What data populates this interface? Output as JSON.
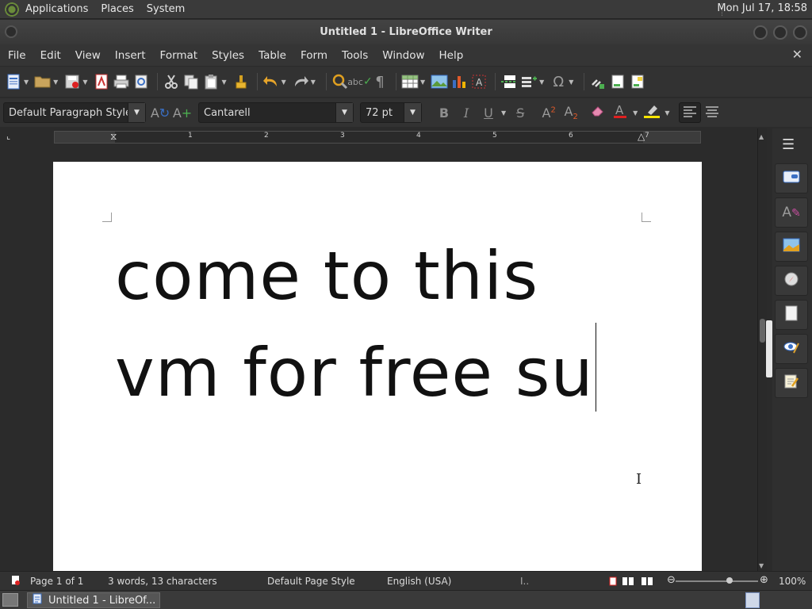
{
  "top_panel": {
    "menus": [
      "Applications",
      "Places",
      "System"
    ],
    "clock": "Mon Jul 17, 18:58"
  },
  "window": {
    "title": "Untitled 1 - LibreOffice Writer"
  },
  "menubar": {
    "items": [
      "File",
      "Edit",
      "View",
      "Insert",
      "Format",
      "Styles",
      "Table",
      "Form",
      "Tools",
      "Window",
      "Help"
    ],
    "close_glyph": "✕"
  },
  "format_toolbar": {
    "paragraph_style": "Default Paragraph Style",
    "font_name": "Cantarell",
    "font_size": "72 pt",
    "bold": "B",
    "italic": "I",
    "underline": "U"
  },
  "ruler": {
    "labels": [
      "1",
      "2",
      "3",
      "4",
      "5",
      "6",
      "7"
    ]
  },
  "document": {
    "lines": [
      "come to this",
      "vm for free su"
    ]
  },
  "statusbar": {
    "page": "Page 1 of 1",
    "word_count": "3 words, 13 characters",
    "page_style": "Default Page Style",
    "language": "English (USA)",
    "zoom": "100%",
    "zoom_level": 1.0
  },
  "taskbar": {
    "task_label": "Untitled 1 - LibreOf..."
  },
  "colors": {
    "font_color_swatch": "#e02020",
    "highlight_swatch": "#f5e400",
    "accent_blue": "#3a6fc4"
  }
}
